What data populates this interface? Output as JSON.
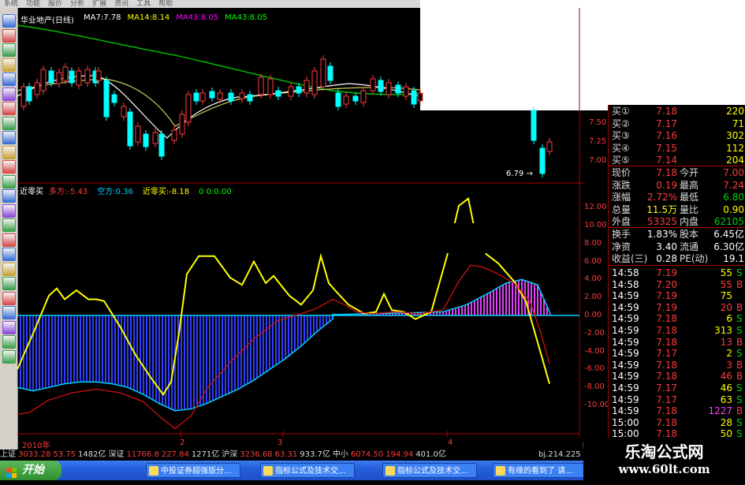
{
  "menu": [
    "系统",
    "功能",
    "报价",
    "分析",
    "扩展",
    "资讯",
    "工具",
    "帮助"
  ],
  "main_chart": {
    "stock_title": "华业地产(日线)",
    "ma_labels": [
      {
        "text": "MA7:7.78",
        "color": "#ffffff"
      },
      {
        "text": "MA14:8.14",
        "color": "#ffff00"
      },
      {
        "text": "MA43:8.05",
        "color": "#ff00ff"
      },
      {
        "text": "MA43:8.05",
        "color": "#00ff00"
      }
    ],
    "price_axis": [
      "7.50",
      "7.25",
      "7.00"
    ],
    "low_mark": "6.79"
  },
  "indicator": {
    "name": "近零买",
    "labels": [
      {
        "text": "多方:-5.43",
        "color": "#ff3b3b"
      },
      {
        "text": "空方:0.36",
        "color": "#00d0ff"
      },
      {
        "text": "近零买:-8.18",
        "color": "#ffff00"
      },
      {
        "text": "0 0:0.00",
        "color": "#00ff00"
      }
    ],
    "axis": [
      "12.00",
      "10.00",
      "8.00",
      "6.00",
      "4.00",
      "2.00",
      "0.00",
      "-2.00",
      "-4.00",
      "-6.00",
      "-8.00",
      "-10.00"
    ],
    "date_labels": [
      "2010年",
      "2",
      "3",
      "4"
    ],
    "period_label": "日线"
  },
  "colors": {
    "bg": "#000000",
    "up": "#ff3b3b",
    "down": "#00ffff",
    "blue_bars": "#2f3dff",
    "magenta_bars": "#e040fb"
  },
  "quote": {
    "bids": [
      {
        "label": "买①",
        "price": "7.18",
        "vol": "220"
      },
      {
        "label": "买②",
        "price": "7.17",
        "vol": "71"
      },
      {
        "label": "买③",
        "price": "7.16",
        "vol": "302"
      },
      {
        "label": "买④",
        "price": "7.15",
        "vol": "112"
      },
      {
        "label": "买⑤",
        "price": "7.14",
        "vol": "204"
      }
    ],
    "stats": [
      {
        "l1": "现价",
        "v1": "7.18",
        "l2": "今开",
        "v2": "7.00"
      },
      {
        "l1": "涨跌",
        "v1": "0.19",
        "l2": "最高",
        "v2": "7.24"
      },
      {
        "l1": "涨幅",
        "v1": "2.72%",
        "l2": "最低",
        "v2": "6.80"
      },
      {
        "l1": "总量",
        "v1": "11.5万",
        "l2": "量比",
        "v2": "0.90"
      },
      {
        "l1": "外盘",
        "v1": "53325",
        "l2": "内盘",
        "v2": "62105"
      }
    ],
    "fund": [
      {
        "l1": "换手",
        "v1": "1.83%",
        "l2": "股本",
        "v2": "6.45亿"
      },
      {
        "l1": "净资",
        "v1": "3.40",
        "l2": "流通",
        "v2": "6.30亿"
      },
      {
        "l1": "收益(三)",
        "v1": "0.28",
        "l2": "PE(动)",
        "v2": "19.1"
      }
    ],
    "ticks": [
      {
        "t": "14:58",
        "p": "7.19",
        "v": "55",
        "s": "S"
      },
      {
        "t": "14:58",
        "p": "7.20",
        "v": "55",
        "s": "B"
      },
      {
        "t": "14:59",
        "p": "7.19",
        "v": "75",
        "s": ""
      },
      {
        "t": "14:59",
        "p": "7.19",
        "v": "20",
        "s": "B"
      },
      {
        "t": "14:59",
        "p": "7.18",
        "v": "6",
        "s": "S"
      },
      {
        "t": "14:59",
        "p": "7.18",
        "v": "313",
        "s": "S"
      },
      {
        "t": "14:59",
        "p": "7.18",
        "v": "13",
        "s": "B"
      },
      {
        "t": "14:59",
        "p": "7.17",
        "v": "2",
        "s": "S"
      },
      {
        "t": "14:59",
        "p": "7.18",
        "v": "3",
        "s": "B"
      },
      {
        "t": "14:59",
        "p": "7.18",
        "v": "46",
        "s": "B"
      },
      {
        "t": "14:59",
        "p": "7.17",
        "v": "46",
        "s": "S"
      },
      {
        "t": "14:59",
        "p": "7.17",
        "v": "63",
        "s": "S"
      },
      {
        "t": "14:59",
        "p": "7.18",
        "v": "1227",
        "s": "B"
      },
      {
        "t": "15:00",
        "p": "7.18",
        "v": "28",
        "s": "S"
      },
      {
        "t": "15:00",
        "p": "7.18",
        "v": "50",
        "s": "S"
      }
    ]
  },
  "status_bar": [
    {
      "text": "上证",
      "color": "#dddddd"
    },
    {
      "text": "3033.28",
      "color": "#ff3b3b"
    },
    {
      "text": "53.75",
      "color": "#ff3b3b"
    },
    {
      "text": "1482亿",
      "color": "#dddddd"
    },
    {
      "text": "深证",
      "color": "#dddddd"
    },
    {
      "text": "11766.8",
      "color": "#ff3b3b"
    },
    {
      "text": "227.84",
      "color": "#ff3b3b"
    },
    {
      "text": "1271亿",
      "color": "#dddddd"
    },
    {
      "text": "沪深",
      "color": "#dddddd"
    },
    {
      "text": "3236.68",
      "color": "#ff3b3b"
    },
    {
      "text": "63.31",
      "color": "#ff3b3b"
    },
    {
      "text": "933.7亿",
      "color": "#dddddd"
    },
    {
      "text": "中小",
      "color": "#dddddd"
    },
    {
      "text": "6074.50",
      "color": "#ff3b3b"
    },
    {
      "text": "194.94",
      "color": "#ff3b3b"
    },
    {
      "text": "401.0亿",
      "color": "#dddddd"
    }
  ],
  "status_right": "bj.214.225",
  "taskbar": {
    "start": "开始",
    "tasks": [
      "中投证券超强版分...",
      "指标公式及技术交...",
      "指标公式及技术交...",
      "有缘的看到了 请..."
    ]
  },
  "watermark": {
    "title": "乐淘公式网",
    "url": "www.60lt.com"
  }
}
